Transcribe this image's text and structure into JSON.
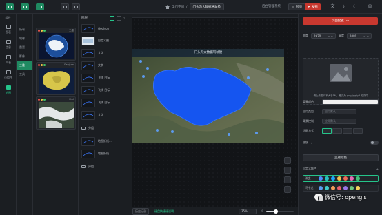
{
  "topbar": {
    "crumb": "工作空间",
    "project": "门头沟大数据驾驶舱",
    "admin_link": "后台管理系统",
    "preview_label": "预览",
    "publish_label": "发布",
    "tool_icons": [
      "image-icon",
      "image-icon",
      "save-icon",
      "undo-icon",
      "redo-icon"
    ]
  },
  "nav": {
    "header": "组件",
    "items": [
      {
        "label": "图表",
        "icon": "chart-icon"
      },
      {
        "label": "信息",
        "icon": "info-icon"
      },
      {
        "label": "列表",
        "icon": "list-icon"
      },
      {
        "label": "小组件",
        "icon": "widget-icon"
      },
      {
        "label": "地图",
        "icon": "map-icon",
        "active": true
      }
    ]
  },
  "categories": [
    "所有",
    "地球",
    "重要",
    "影像...",
    "三维",
    "工具"
  ],
  "thumbs": [
    {
      "label": "三维"
    },
    {
      "label": "Geojson"
    },
    {
      "label": "Kml"
    }
  ],
  "components": {
    "header": "图层",
    "items": [
      {
        "label": "Geojson",
        "kind": "dark"
      },
      {
        "label": "自定义图",
        "kind": "light"
      },
      {
        "label": "文字",
        "kind": "dark"
      },
      {
        "label": "文字",
        "kind": "dark"
      },
      {
        "label": "飞线 目标",
        "kind": "dark"
      },
      {
        "label": "飞线 目标",
        "kind": "dark"
      },
      {
        "label": "飞线 目标",
        "kind": "dark"
      },
      {
        "label": "文字",
        "kind": "dark"
      },
      {
        "label": "分组",
        "kind": "folder"
      },
      {
        "label": "地图折线...",
        "kind": "dark"
      },
      {
        "label": "地图折线...",
        "kind": "dark"
      },
      {
        "label": "分组",
        "kind": "folder"
      }
    ]
  },
  "scene": {
    "title": "门头沟大数据驾驶舱",
    "colors": {
      "region": "#1555f0",
      "land": "#4d5a3e"
    }
  },
  "bottombar": {
    "history_label": "历史记录",
    "shortcut_label": "键盘快捷键说明",
    "zoom": "35%",
    "zoom_level": 0.35
  },
  "panel": {
    "tab_label": "页面配置",
    "width_label": "宽度",
    "width_value": "1920",
    "height_label": "高度",
    "height_value": "1080",
    "upload_tip": "请上传图片不大于5M，格式为 png/jpg/gif 的文件",
    "bgcolor_label": "背景颜色",
    "apply_label": "应用类型",
    "apply_value": "应用默认",
    "bgcontrol_label": "背景控制",
    "bgcontrol_value": "应用默认",
    "fit_label": "适配方式",
    "filter_label": "滤镜",
    "theme_btn": "主题颜色",
    "custom_label": "自定义颜色",
    "swatch_rows": [
      {
        "label": "渐变",
        "active": true,
        "colors": [
          "#4f8cff",
          "#27c1c1",
          "#1ea7ff",
          "#f6c34b",
          "#ef6b57",
          "#e66bb5",
          "#43c07a"
        ]
      },
      {
        "label": "马卡龙",
        "active": false,
        "colors": [
          "#5a9bf0",
          "#40c8c8",
          "#f29c5a",
          "#e85d6a",
          "#9a77e8",
          "#6bc77d",
          "#f5d15b"
        ]
      }
    ]
  },
  "watermark": "微信号: opengis"
}
